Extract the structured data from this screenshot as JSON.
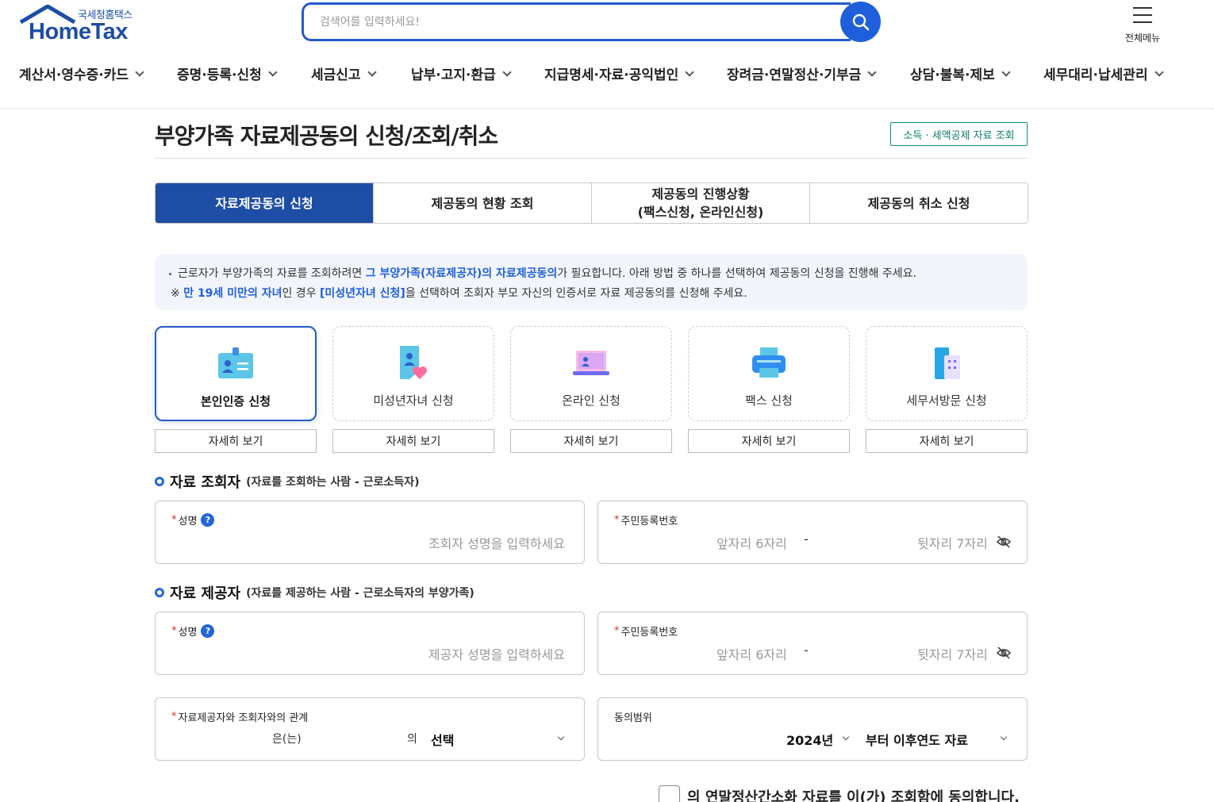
{
  "header": {
    "logo_small": "국세청홈택스",
    "logo_big": "HomeTax",
    "search_placeholder": "검색어를 입력하세요!",
    "all_menu_label": "전체메뉴"
  },
  "gnb": {
    "items": [
      {
        "label": "계산서·영수증·카드"
      },
      {
        "label": "증명·등록·신청"
      },
      {
        "label": "세금신고"
      },
      {
        "label": "납부·고지·환급"
      },
      {
        "label": "지급명세·자료·공익법인"
      },
      {
        "label": "장려금·연말정산·기부금"
      },
      {
        "label": "상담·불복·제보"
      },
      {
        "label": "세무대리·납세관리"
      }
    ]
  },
  "page": {
    "title": "부양가족 자료제공동의 신청/조회/취소",
    "title_button": "소득 · 세액공제 자료 조회"
  },
  "tabs": [
    {
      "line1": "자료제공동의 신청",
      "line2": ""
    },
    {
      "line1": "제공동의 현황 조회",
      "line2": ""
    },
    {
      "line1": "제공동의 진행상황",
      "line2": "(팩스신청, 온라인신청)"
    },
    {
      "line1": "제공동의 취소 신청",
      "line2": ""
    }
  ],
  "notice": {
    "line1_pre": "근로자가 부양가족의 자료를 조회하려면 ",
    "line1_hl": "그 부양가족(자료제공자)의 자료제공동의",
    "line1_post": "가 필요합니다. 아래 방법 중 하나를 선택하여 제공동의 신청을 진행해 주세요.",
    "line2_pre": "※ ",
    "line2_hl1": "만 19세 미만의 자녀",
    "line2_mid": "인 경우 ",
    "line2_hl2": "[미성년자녀 신청]",
    "line2_post": "을 선택하여 조회자 부모 자신의 인증서로 자료 제공동의를 신청해 주세요."
  },
  "methods": [
    {
      "label": "본인인증 신청",
      "icon": "id-card-icon",
      "detail": "자세히 보기"
    },
    {
      "label": "미성년자녀 신청",
      "icon": "child-heart-icon",
      "detail": "자세히 보기"
    },
    {
      "label": "온라인 신청",
      "icon": "laptop-icon",
      "detail": "자세히 보기"
    },
    {
      "label": "팩스 신청",
      "icon": "fax-icon",
      "detail": "자세히 보기"
    },
    {
      "label": "세무서방문 신청",
      "icon": "building-icon",
      "detail": "자세히 보기"
    }
  ],
  "viewer": {
    "title": "자료 조회자",
    "sub": "(자료를 조회하는 사람 - 근로소득자)",
    "name_label": "성명",
    "name_placeholder": "조회자 성명을 입력하세요",
    "rrn_label": "주민등록번호",
    "rrn_front_placeholder": "앞자리 6자리",
    "rrn_back_placeholder": "뒷자리 7자리"
  },
  "provider": {
    "title": "자료 제공자",
    "sub": "(자료를 제공하는 사람 - 근로소득자의 부양가족)",
    "name_label": "성명",
    "name_placeholder": "제공자 성명을 입력하세요",
    "rrn_label": "주민등록번호",
    "rrn_front_placeholder": "앞자리 6자리",
    "rrn_back_placeholder": "뒷자리 7자리"
  },
  "relation": {
    "label": "자료제공자와 조회자와의 관계",
    "text1": "은(는)",
    "text2": "의",
    "select_value": "선택"
  },
  "scope": {
    "label": "동의범위",
    "year_value": "2024년",
    "range_value": "부터 이후연도 자료"
  },
  "consent": {
    "text": "의 연말정산간소화 자료를 이(가) 조회함에 동의합니다."
  },
  "colors": {
    "primary": "#1d4da5",
    "accent": "#1f5fdb",
    "teal": "#0d7b6e",
    "required": "#d32f2f"
  }
}
